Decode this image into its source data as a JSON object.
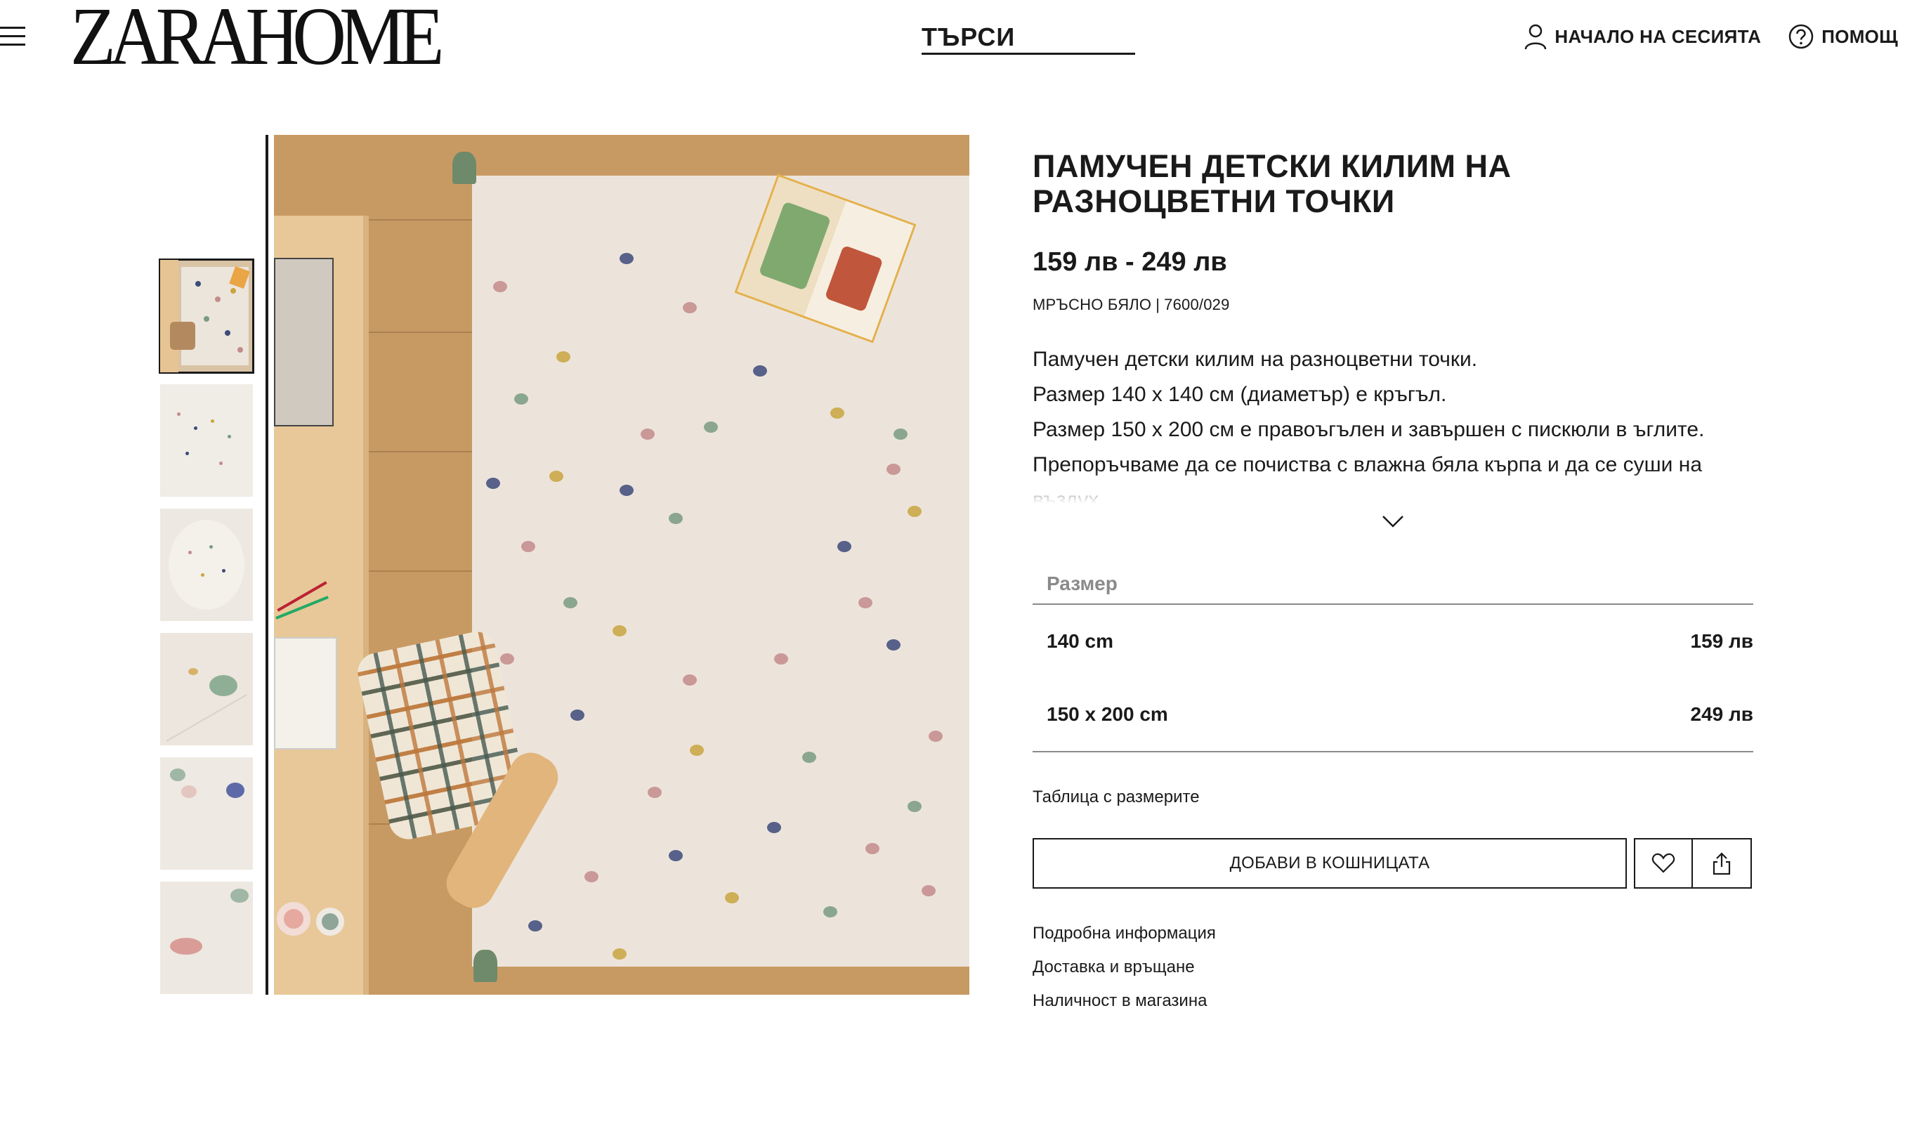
{
  "header": {
    "logo_text": "ZARAHOME",
    "search_label": "ТЪРСИ",
    "login_label": "НАЧАЛО НА СЕСИЯТА",
    "help_label": "ПОМОЩ"
  },
  "product": {
    "title": "ПАМУЧЕН ДЕТСКИ КИЛИМ НА РАЗНОЦВЕТНИ ТОЧКИ",
    "price_range": "159 лв - 249 лв",
    "color": "МРЪСНО БЯЛО",
    "reference": "7600/029",
    "description": [
      "Памучен детски килим на разноцветни точки.",
      "Размер 140 x 140 см (диаметър) е кръгъл.",
      "Размер 150 x 200 см е правоъгълен и завършен с пискюли в ъглите.",
      "Препоръчваме да се почиства с влажна бяла кърпа и да се суши на въздух."
    ]
  },
  "sizes": {
    "header": "Размер",
    "options": [
      {
        "label": "140 cm",
        "price": "159 лв"
      },
      {
        "label": "150 x 200 cm",
        "price": "249 лв"
      }
    ],
    "guide_label": "Таблица с размерите"
  },
  "actions": {
    "add_to_cart": "ДОБАВИ В КОШНИЦАТА",
    "wishlist_icon": "heart-icon",
    "share_icon": "share-icon"
  },
  "info_links": [
    "Подробна информация",
    "Доставка и връщане",
    "Наличност в магазина"
  ],
  "gallery": {
    "thumbnail_count": 6,
    "active_index": 0
  }
}
